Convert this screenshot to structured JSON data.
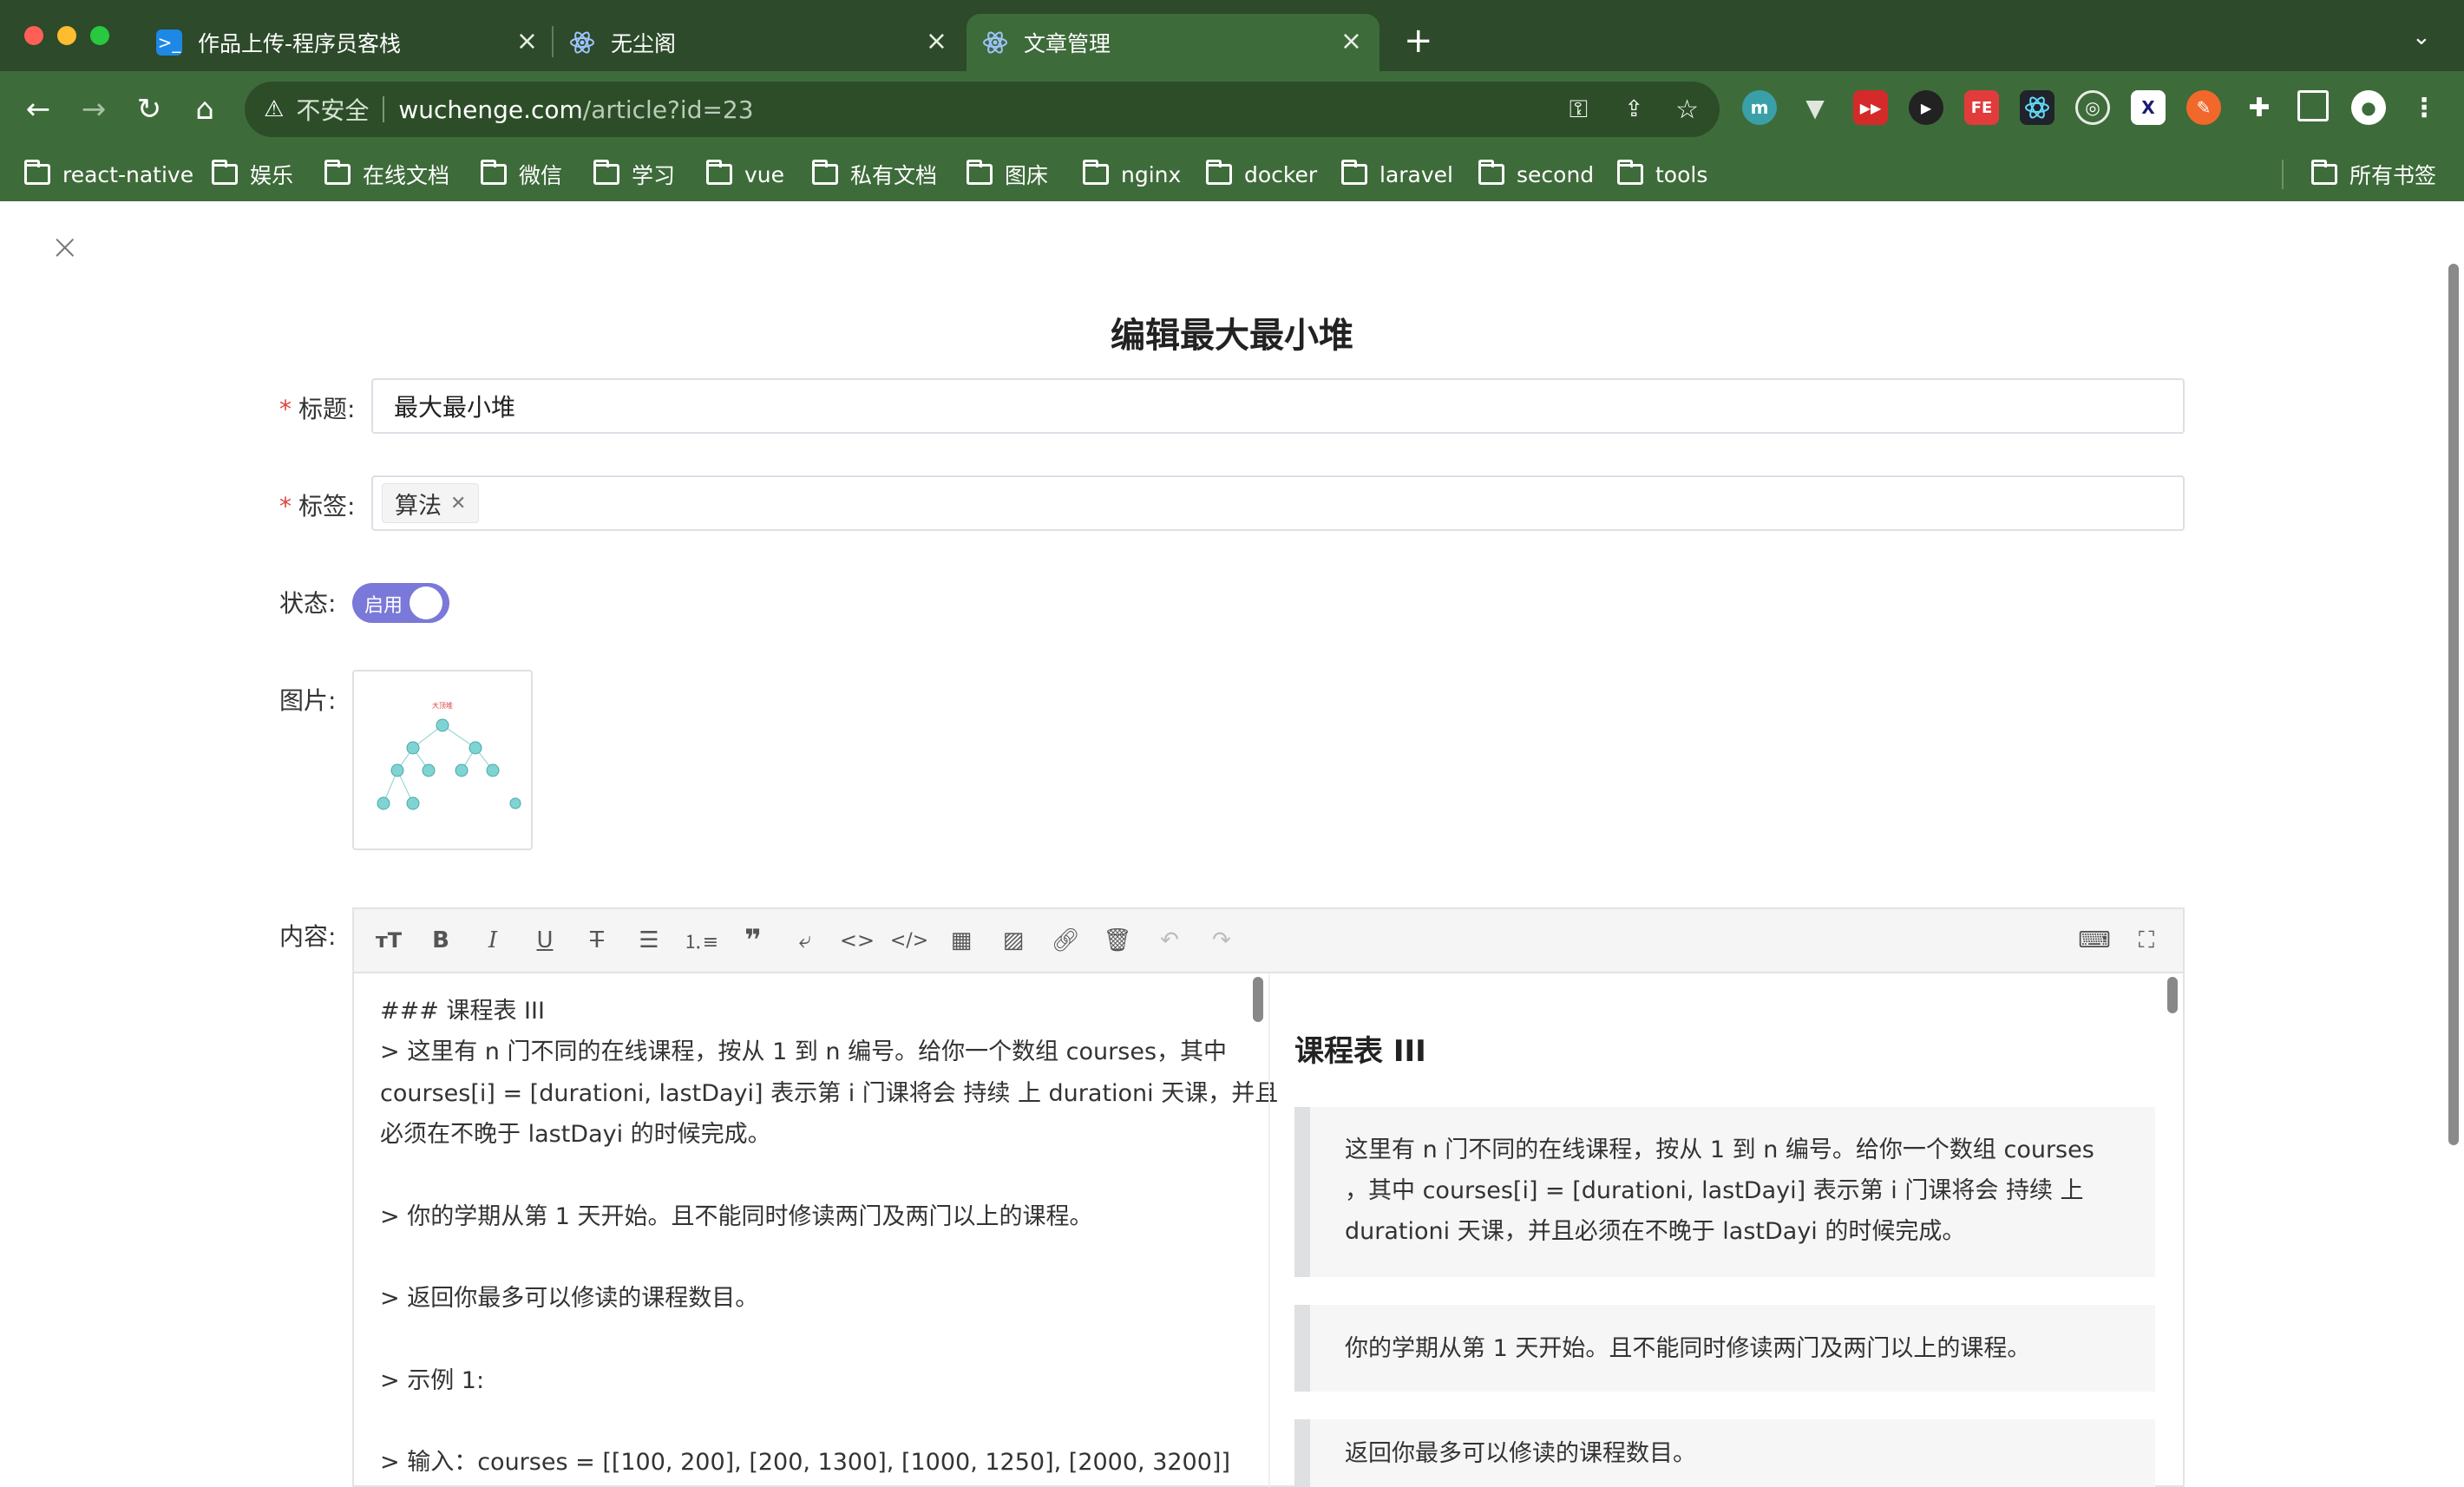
{
  "browser": {
    "tabs": [
      {
        "title": "作品上传-程序员客栈",
        "icon": "terminal-icon"
      },
      {
        "title": "无尘阁",
        "icon": "react-icon"
      },
      {
        "title": "文章管理",
        "icon": "react-icon"
      }
    ],
    "address": {
      "security": "不安全",
      "host": "wuchenge.com",
      "path": "/article?id=23"
    },
    "bookmarks": [
      "react-native",
      "娱乐",
      "在线文档",
      "微信",
      "学习",
      "vue",
      "私有文档",
      "图床",
      "nginx",
      "docker",
      "laravel",
      "second",
      "tools"
    ],
    "all_bookmarks": "所有书签",
    "colors": {
      "chrome_dark": "#2d4a2a",
      "chrome": "#3e6b3a",
      "omnibox": "#2c4d28"
    }
  },
  "form": {
    "heading": "编辑最大最小堆",
    "title_label": "标题:",
    "title_value": "最大最小堆",
    "tags_label": "标签:",
    "tags": [
      "算法"
    ],
    "status_label": "状态:",
    "status_value": "启用",
    "image_label": "图片:",
    "content_label": "内容:",
    "image_labels": {
      "top": "大顶堆"
    }
  },
  "editor": {
    "toolbar": [
      "heading-icon",
      "bold-icon",
      "italic-icon",
      "underline-icon",
      "strikethrough-icon",
      "unordered-list-icon",
      "ordered-list-icon",
      "quote-icon",
      "wrap-icon",
      "inline-code-icon",
      "code-block-icon",
      "table-icon",
      "image-icon",
      "link-icon",
      "clear-icon",
      "undo-icon",
      "redo-icon",
      "keyboard-icon",
      "fullscreen-icon"
    ],
    "source_lines": [
      "### 课程表 III",
      "> 这里有 n 门不同的在线课程，按从 1 到 n 编号。给你一个数组 courses，其中",
      "courses[i] = [durationi, lastDayi] 表示第 i 门课将会 持续 上 durationi 天课，并且",
      "必须在不晚于 lastDayi 的时候完成。",
      "",
      "> 你的学期从第 1 天开始。且不能同时修读两门及两门以上的课程。",
      "",
      "> 返回你最多可以修读的课程数目。",
      "",
      "> 示例 1:",
      "",
      "> 输入：courses = [[100, 200], [200, 1300], [1000, 1250], [2000, 3200]]"
    ],
    "preview": {
      "heading": "课程表 III",
      "quote1": [
        "这里有 n 门不同的在线课程，按从 1 到 n 编号。给你一个数组 courses",
        "，其中 courses[i] = [durationi, lastDayi] 表示第 i 门课将会 持续 上",
        "durationi 天课，并且必须在不晚于 lastDayi 的时候完成。"
      ],
      "quote2": "你的学期从第 1 天开始。且不能同时修读两门及两门以上的课程。",
      "quote3": "返回你最多可以修读的课程数目。"
    }
  },
  "colors": {
    "accent": "#7a78d8",
    "required": "#e0403b"
  }
}
